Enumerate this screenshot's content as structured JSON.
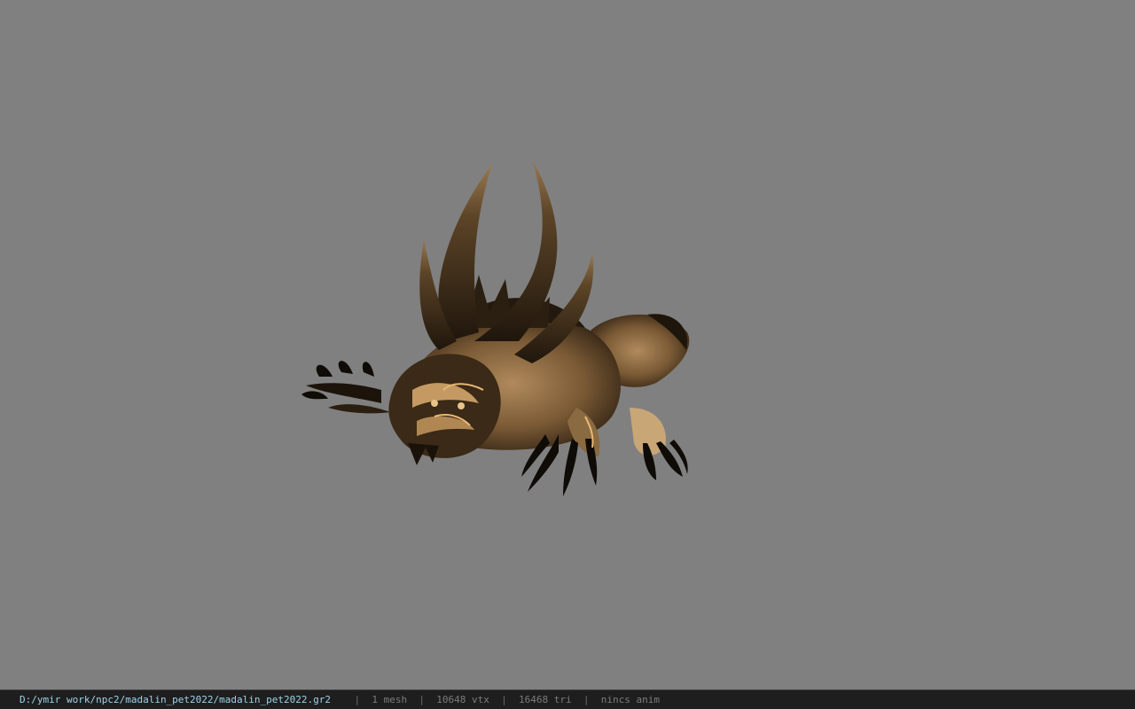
{
  "viewport": {
    "background_color": "#808080",
    "model_name": "creature-model"
  },
  "statusbar": {
    "file_path": "D:/ymir work/npc2/madalin_pet2022/madalin_pet2022.gr2",
    "separator": "|",
    "mesh_count": "1 mesh",
    "vertex_count": "10648 vtx",
    "triangle_count": "16468 tri",
    "anim_status": "nincs anim",
    "colors": {
      "background": "#1e1e1e",
      "path": "#9fd3ea",
      "text": "#7c7c7c"
    }
  }
}
